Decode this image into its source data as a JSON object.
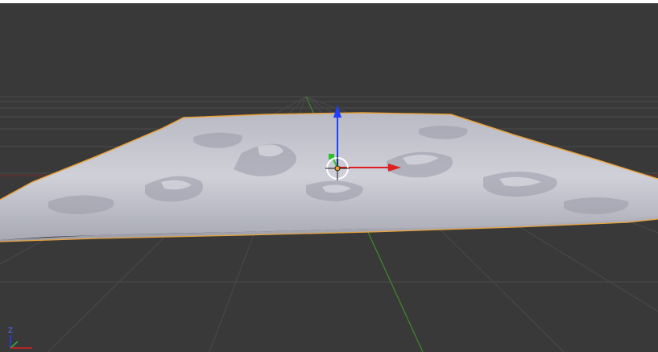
{
  "viewport": {
    "background": "#393939",
    "grid_line_color": "#4a4a4a",
    "x_axis_color": "#9a2a2a",
    "y_axis_color": "#3f8a2a"
  },
  "terrain": {
    "surface_color": "#c5c6d0",
    "shadow_color": "#9e9faa",
    "selection_outline_color": "#e8a23a"
  },
  "manipulator": {
    "x_color": "#e02020",
    "y_color": "#2ec02e",
    "z_color": "#2040ff",
    "pivot_color": "#ffffff"
  },
  "orientation_gizmo": {
    "z_label": "Z"
  },
  "icons": {
    "transform_gizmo": "move-manipulator-icon",
    "origin": "object-origin-icon",
    "axes": "view-axes-icon"
  }
}
